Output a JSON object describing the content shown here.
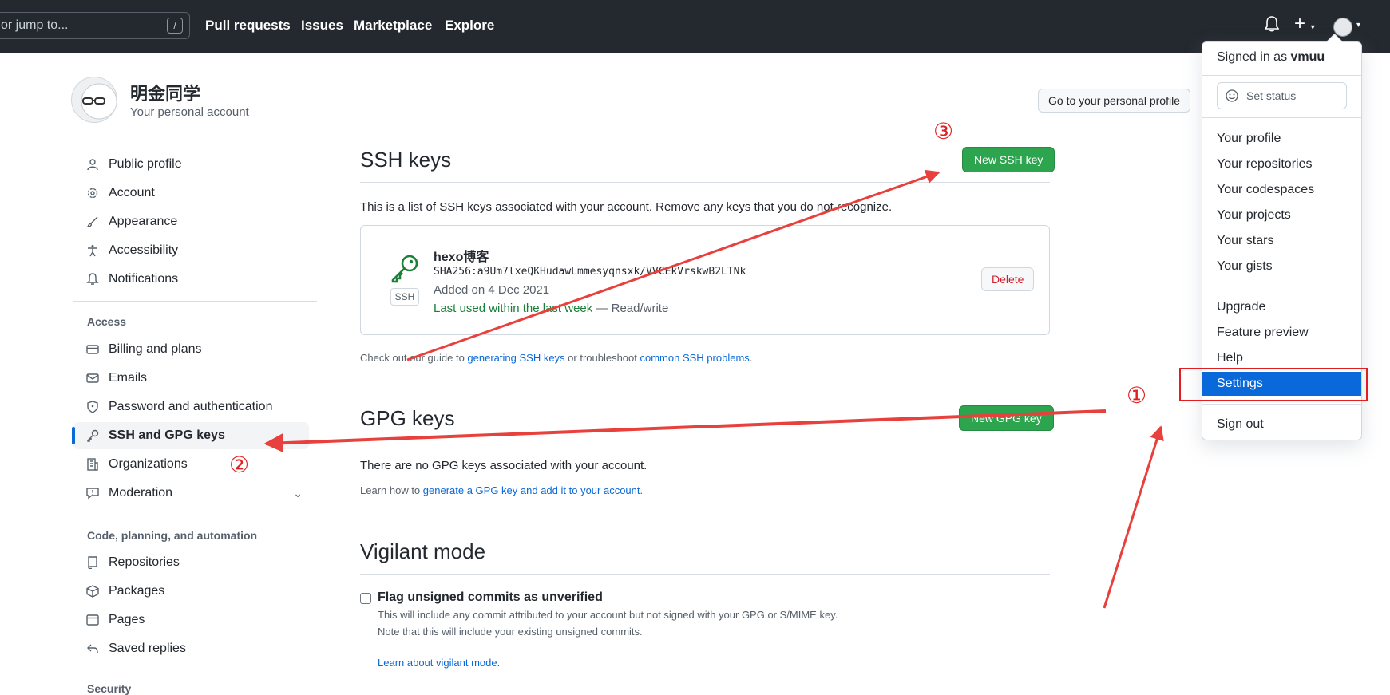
{
  "header": {
    "search_placeholder": "or jump to...",
    "search_shortcut": "/",
    "nav": [
      "Pull requests",
      "Issues",
      "Marketplace",
      "Explore"
    ],
    "plus_label": "+"
  },
  "account": {
    "name": "明金同学",
    "subtitle": "Your personal account",
    "profile_button": "Go to your personal profile"
  },
  "sidebar": {
    "items_top": [
      {
        "label": "Public profile",
        "icon": "person-icon"
      },
      {
        "label": "Account",
        "icon": "gear-icon"
      },
      {
        "label": "Appearance",
        "icon": "paintbrush-icon"
      },
      {
        "label": "Accessibility",
        "icon": "accessibility-icon"
      },
      {
        "label": "Notifications",
        "icon": "bell-icon"
      }
    ],
    "access_heading": "Access",
    "items_access": [
      {
        "label": "Billing and plans",
        "icon": "credit-card-icon"
      },
      {
        "label": "Emails",
        "icon": "mail-icon"
      },
      {
        "label": "Password and authentication",
        "icon": "shield-icon"
      },
      {
        "label": "SSH and GPG keys",
        "icon": "key-icon"
      },
      {
        "label": "Organizations",
        "icon": "organization-icon"
      },
      {
        "label": "Moderation",
        "icon": "report-icon"
      }
    ],
    "code_heading": "Code, planning, and automation",
    "items_code": [
      {
        "label": "Repositories",
        "icon": "repo-icon"
      },
      {
        "label": "Packages",
        "icon": "package-icon"
      },
      {
        "label": "Pages",
        "icon": "browser-icon"
      },
      {
        "label": "Saved replies",
        "icon": "reply-icon"
      }
    ],
    "security_heading": "Security"
  },
  "ssh": {
    "title": "SSH keys",
    "new_button": "New SSH key",
    "description": "This is a list of SSH keys associated with your account. Remove any keys that you do not recognize.",
    "key": {
      "title": "hexo博客",
      "fingerprint": "SHA256:a9Um7lxeQKHudawLmmesyqnsxk/VVCEkVrskwB2LTNk",
      "added": "Added on 4 Dec 2021",
      "last_used": "Last used within the last week",
      "access": " — Read/write",
      "badge": "SSH",
      "delete_button": "Delete"
    },
    "guide_prefix": "Check out our guide to ",
    "guide_link1": "generating SSH keys",
    "guide_mid": " or troubleshoot ",
    "guide_link2": "common SSH problems",
    "guide_suffix": "."
  },
  "gpg": {
    "title": "GPG keys",
    "new_button": "New GPG key",
    "empty": "There are no GPG keys associated with your account.",
    "learn_prefix": "Learn how to ",
    "learn_link": "generate a GPG key and add it to your account",
    "learn_suffix": "."
  },
  "vigilant": {
    "title": "Vigilant mode",
    "checkbox_label": "Flag unsigned commits as unverified",
    "line1": "This will include any commit attributed to your account but not signed with your GPG or S/MIME key.",
    "line2": "Note that this will include your existing unsigned commits.",
    "learn_link": "Learn about vigilant mode."
  },
  "dropdown": {
    "signed_in_prefix": "Signed in as ",
    "username": "vmuu",
    "set_status": "Set status",
    "group1": [
      "Your profile",
      "Your repositories",
      "Your codespaces",
      "Your projects",
      "Your stars",
      "Your gists"
    ],
    "group2": [
      "Upgrade",
      "Feature preview",
      "Help",
      "Settings"
    ],
    "sign_out": "Sign out"
  },
  "annotations": {
    "step1": "①",
    "step2": "②",
    "step3": "③",
    "color": "#e02020"
  }
}
